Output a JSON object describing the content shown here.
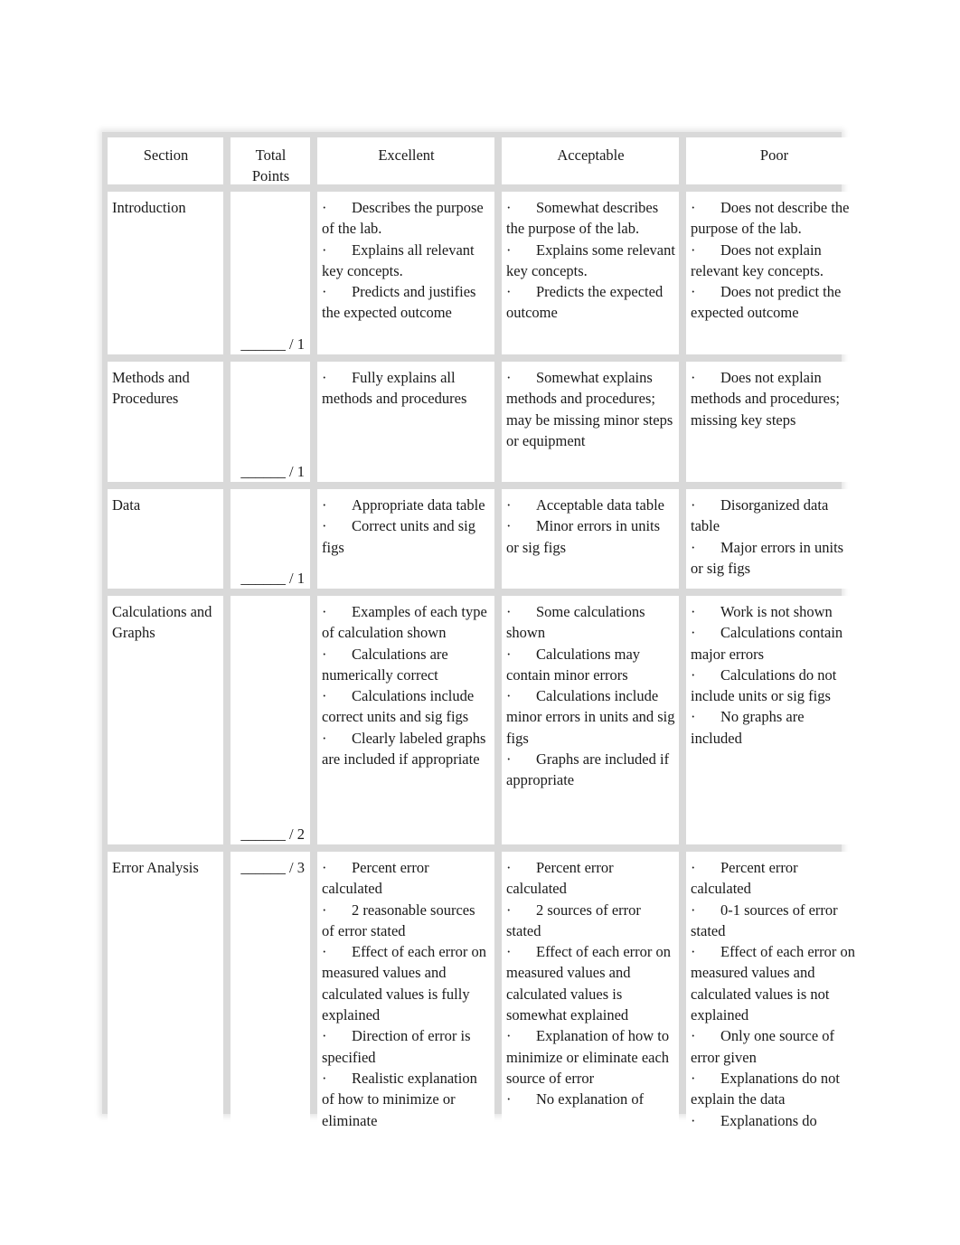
{
  "table": {
    "headers": [
      "Section",
      "Total Points",
      "Excellent",
      "Acceptable",
      "Poor"
    ],
    "header_points_line1": "Total",
    "header_points_line2": "Points",
    "rows": [
      {
        "section": "Introduction",
        "points": "______ / 1",
        "excellent": [
          "Describes the purpose of the lab.",
          "Explains all relevant key concepts.",
          "Predicts and justifies the expected outcome"
        ],
        "acceptable": [
          "Somewhat describes the purpose of the lab.",
          "Explains some relevant key concepts.",
          "Predicts the expected outcome"
        ],
        "poor": [
          "Does not describe the purpose of the lab.",
          "Does not explain relevant key concepts.",
          "Does not predict the expected outcome"
        ]
      },
      {
        "section": "Methods and Procedures",
        "points": "______ / 1",
        "excellent": [
          "Fully explains all methods and procedures"
        ],
        "acceptable": [
          "Somewhat explains methods and procedures; may be missing minor steps or equipment"
        ],
        "poor": [
          "Does not explain methods and procedures; missing key steps"
        ]
      },
      {
        "section": "Data",
        "points": "______ / 1",
        "excellent": [
          "Appropriate data table",
          "Correct units and sig figs"
        ],
        "acceptable": [
          "Acceptable data table",
          "Minor errors in units or sig figs"
        ],
        "poor": [
          "Disorganized data table",
          "Major errors in units or sig figs"
        ]
      },
      {
        "section": "Calculations and Graphs",
        "points": "______ / 2",
        "excellent": [
          "Examples of each type of calculation shown",
          "Calculations are numerically correct",
          "Calculations include correct units and sig figs",
          "Clearly labeled graphs are included if appropriate"
        ],
        "acceptable": [
          "Some calculations shown",
          "Calculations may contain minor errors",
          "Calculations include minor errors in units and sig figs",
          "Graphs are included if appropriate"
        ],
        "poor": [
          "Work is not shown",
          "Calculations contain major errors",
          "Calculations do not include units or sig figs",
          "No graphs are included"
        ]
      },
      {
        "section": "Error Analysis",
        "points": "______ / 3",
        "excellent": [
          "Percent error calculated",
          "2 reasonable sources of error stated",
          "Effect of each error on measured values and calculated values is fully explained",
          "Direction of error is specified",
          "Realistic explanation of how to minimize or eliminate"
        ],
        "acceptable": [
          "Percent error calculated",
          "2 sources of error stated",
          "Effect of each error on measured values and calculated values is somewhat explained",
          "Explanation of how to minimize or eliminate each source of error",
          "No explanation of"
        ],
        "poor": [
          "Percent error calculated",
          "0-1 sources of error stated",
          "Effect of each error on measured values and calculated values is not explained",
          "Only one source of error given",
          "Explanations do not explain the data",
          "Explanations do"
        ]
      }
    ],
    "bullet_glyph": "·"
  }
}
